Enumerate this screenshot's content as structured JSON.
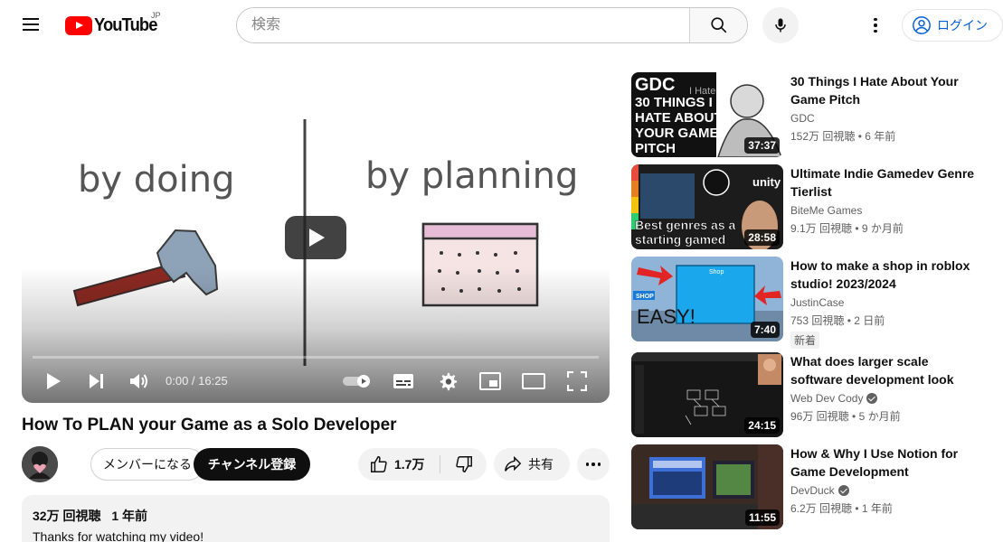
{
  "header": {
    "logo_text": "YouTube",
    "region": "JP",
    "search_placeholder": "検索",
    "login_label": "ログイン"
  },
  "player": {
    "text_left": "by doing",
    "text_right": "by planning",
    "time_display": "0:00 / 16:25",
    "progress_fraction": 0
  },
  "video": {
    "title": "How To PLAN your Game as a Solo Developer",
    "member_label": "メンバーになる",
    "subscribe_label": "チャンネル登録",
    "like_count": "1.7万",
    "share_label": "共有",
    "views": "32万 回視聴",
    "age": "1 年前",
    "description": "Thanks for watching my video!"
  },
  "recommendations": [
    {
      "title": "30 Things I Hate About Your Game Pitch",
      "channel": "GDC",
      "verified": false,
      "views": "152万 回視聴",
      "age": "6 年前",
      "duration": "37:37",
      "badge": "",
      "thumb_lines": [
        "GDC",
        "30 THINGS I",
        "HATE ABOUT",
        "YOUR GAME",
        "PITCH"
      ],
      "thumb_small": "I Hate"
    },
    {
      "title": "Ultimate Indie Gamedev Genre Tierlist",
      "channel": "BiteMe Games",
      "verified": false,
      "views": "9.1万 回視聴",
      "age": "9 か月前",
      "duration": "28:58",
      "badge": "",
      "thumb_lines": [
        "Best genres as a",
        "starting gamed"
      ],
      "thumb_small": "unity"
    },
    {
      "title": "How to make a shop in roblox studio! 2023/2024",
      "channel": "JustinCase",
      "verified": false,
      "views": "753 回視聴",
      "age": "2 日前",
      "duration": "7:40",
      "badge": "新着",
      "thumb_lines": [
        "EASY!",
        "SHOP",
        "Shop"
      ],
      "thumb_small": ""
    },
    {
      "title": "What does larger scale software development look like?",
      "channel": "Web Dev Cody",
      "verified": true,
      "views": "96万 回視聴",
      "age": "5 か月前",
      "duration": "24:15",
      "badge": "",
      "thumb_lines": [],
      "thumb_small": ""
    },
    {
      "title": "How & Why I Use Notion for Game Development",
      "channel": "DevDuck",
      "verified": true,
      "views": "6.2万 回視聴",
      "age": "1 年前",
      "duration": "11:55",
      "badge": "",
      "thumb_lines": [],
      "thumb_small": ""
    }
  ],
  "colors": {
    "brand_red": "#ff0000",
    "link_blue": "#065fd4",
    "text_primary": "#0f0f0f",
    "text_secondary": "#606060",
    "chip_bg": "#f2f2f2"
  },
  "icons": [
    "menu-icon",
    "youtube-logo-icon",
    "search-icon",
    "mic-icon",
    "more-vert-icon",
    "account-icon",
    "play-icon",
    "next-icon",
    "volume-icon",
    "autoplay-toggle-icon",
    "subtitles-icon",
    "settings-icon",
    "miniplayer-icon",
    "theater-icon",
    "fullscreen-icon",
    "thumbs-up-icon",
    "thumbs-down-icon",
    "share-icon",
    "more-horiz-icon",
    "verified-icon"
  ]
}
